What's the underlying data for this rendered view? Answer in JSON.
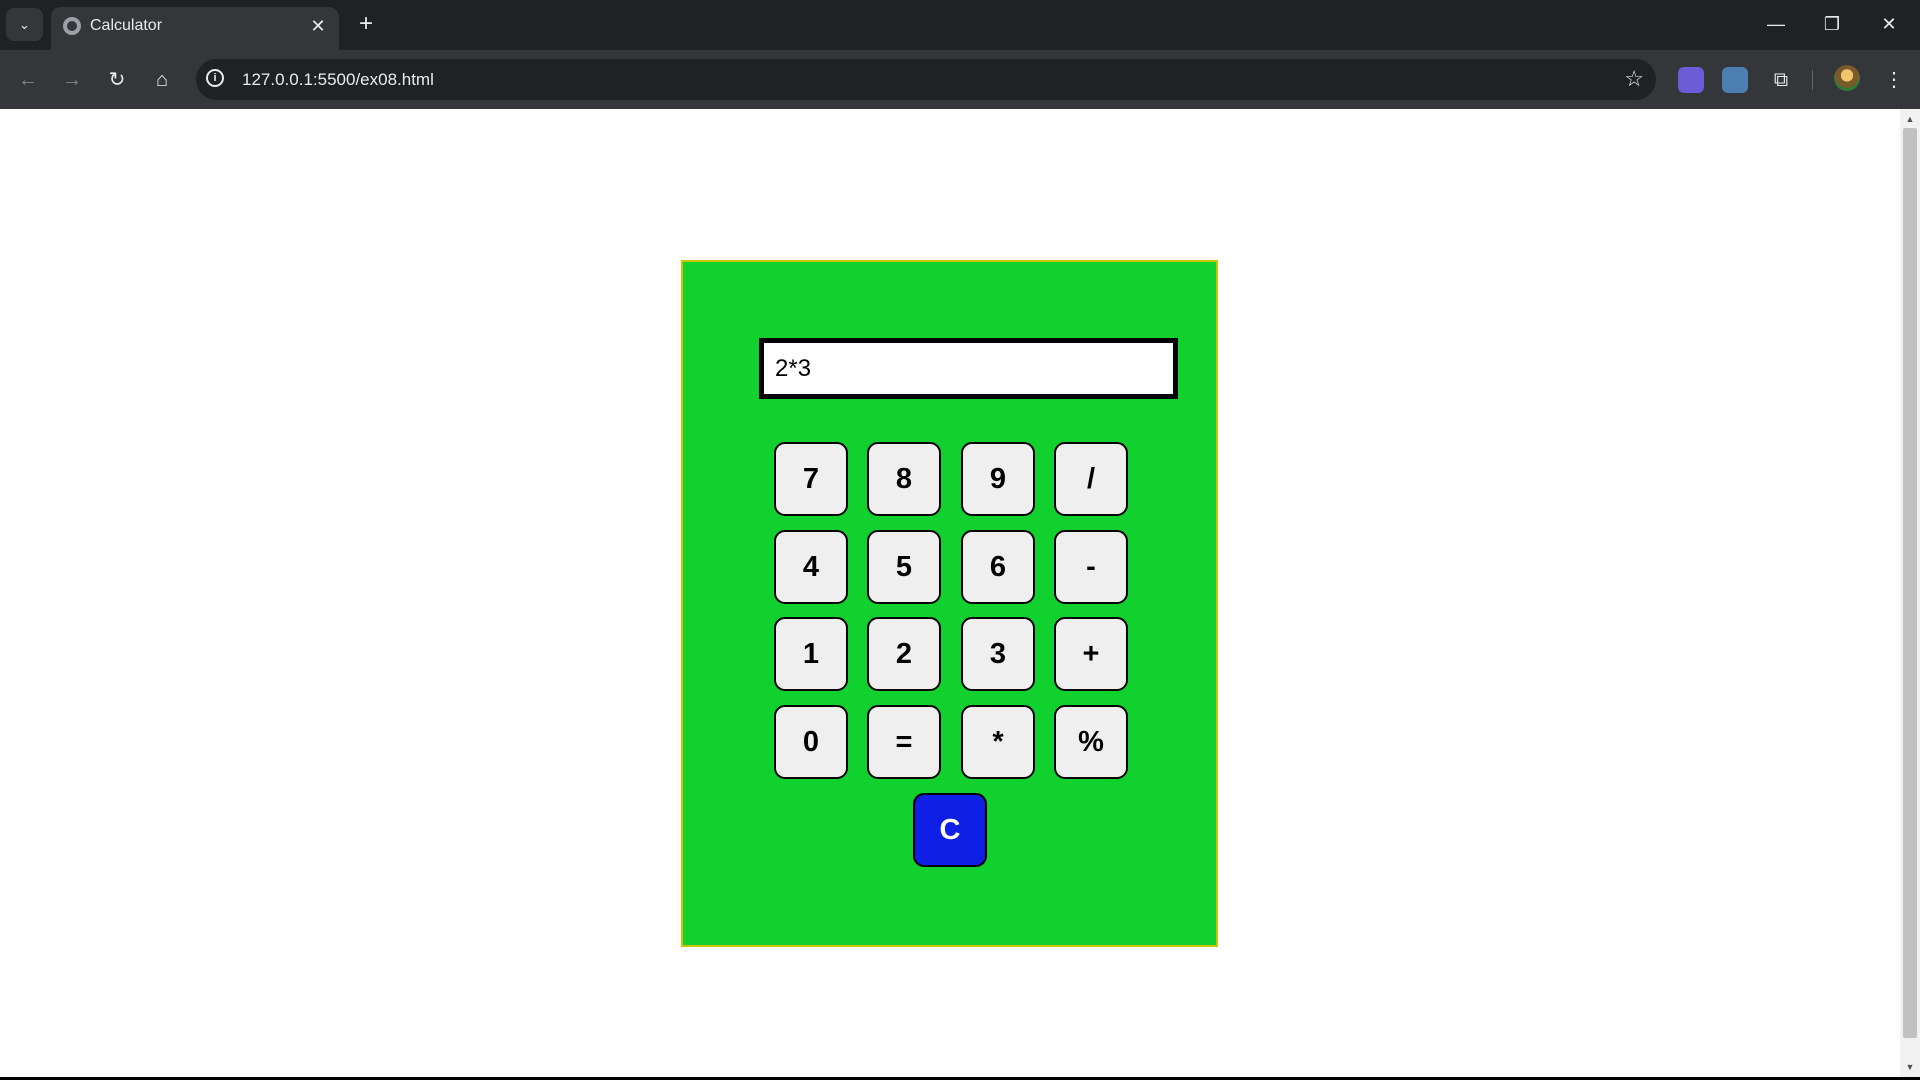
{
  "browser": {
    "tab_title": "Calculator",
    "tab_close": "✕",
    "new_tab": "+",
    "url": "127.0.0.1:5500/ex08.html",
    "window_controls": {
      "minimize": "—",
      "restore": "❐",
      "close": "✕"
    }
  },
  "calculator": {
    "display_value": "2*3",
    "keys": [
      [
        "7",
        "8",
        "9",
        "/"
      ],
      [
        "4",
        "5",
        "6",
        "-"
      ],
      [
        "1",
        "2",
        "3",
        "+"
      ],
      [
        "0",
        "=",
        "*",
        "%"
      ]
    ],
    "clear_label": "C",
    "colors": {
      "panel": "#11d12f",
      "clear_button": "#0f1fe6",
      "key": "#efefef"
    }
  }
}
